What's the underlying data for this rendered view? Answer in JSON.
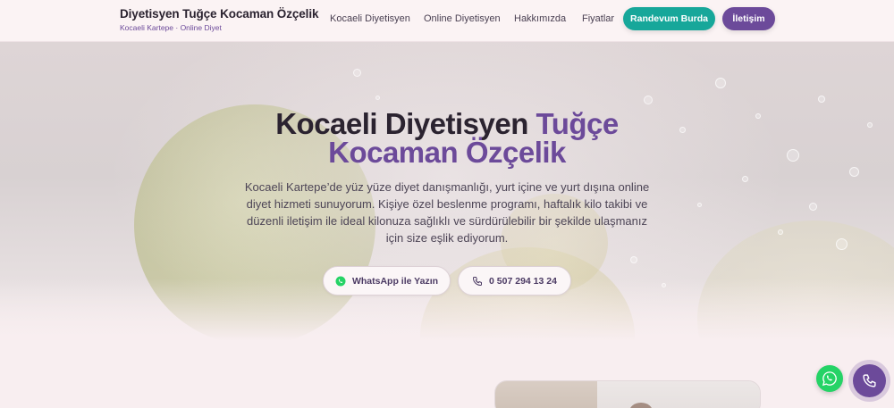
{
  "header": {
    "brand_title": "Diyetisyen Tuğçe Kocaman Özçelik",
    "brand_subtitle": "Kocaeli Kartepe · Online Diyet",
    "nav": [
      "Kocaeli Diyetisyen",
      "Online Diyetisyen",
      "Hakkımızda",
      "Fiyatlar"
    ],
    "appointment_label": "Randevum Burda",
    "contact_label": "İletişim"
  },
  "hero": {
    "title_part1": "Kocaeli Diyetisyen",
    "title_part2": "Tuğçe",
    "title_part3": "Kocaman Özçelik",
    "lead_lines": [
      "Kocaeli Kartepe’de yüz yüze diyet danışmanlığı, yurt içine ve yurt dışına online",
      "diyet hizmeti sunuyorum. Kişiye özel beslenme programı, haftalık kilo takibi ve",
      "düzenli iletişim ile ideal kilonuza sağlıklı ve sürdürülebilir bir şekilde ulaşmanız",
      "için size eşlik ediyorum."
    ],
    "whatsapp_label": "WhatsApp ile Yazın",
    "phone_label": "0 507 294 13 24"
  },
  "colors": {
    "accent_purple": "#6c4a9a",
    "accent_teal": "#17a79a",
    "whatsapp_green": "#25d366"
  },
  "icons": {
    "whatsapp": "whatsapp-icon",
    "phone": "phone-icon"
  }
}
